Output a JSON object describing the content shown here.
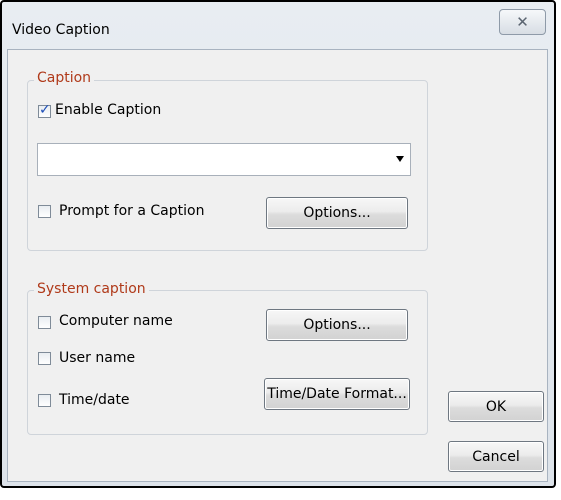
{
  "window": {
    "title": "Video Caption",
    "close_glyph": "✕"
  },
  "caption_group": {
    "legend": "Caption",
    "enable_label": "Enable Caption",
    "enable_checked": true,
    "caption_value": "",
    "prompt_label": "Prompt for a Caption",
    "prompt_checked": false,
    "options_label": "Options..."
  },
  "system_group": {
    "legend": "System caption",
    "computer_label": "Computer name",
    "user_label": "User name",
    "time_label": "Time/date",
    "options_label": "Options...",
    "format_label": "Time/Date Format..."
  },
  "footer": {
    "ok_label": "OK",
    "cancel_label": "Cancel"
  },
  "colors": {
    "legend": "#b03a1a",
    "check": "#1e4fb8"
  }
}
